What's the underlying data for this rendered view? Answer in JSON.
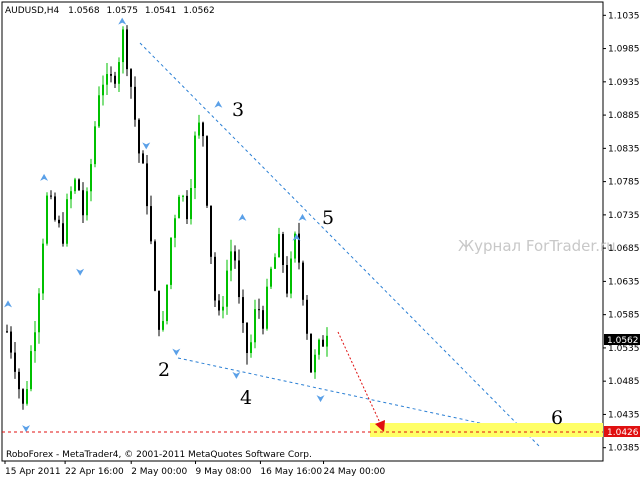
{
  "header": {
    "symbol": "AUDUSD,H4",
    "open": "1.0568",
    "high": "1.0575",
    "low": "1.0541",
    "close": "1.0562"
  },
  "watermark": "Журнал ForTrader.ru",
  "footer": {
    "copyright": "RoboForex - MetaTrader4, © 2001-2011 MetaQuotes Software Corp."
  },
  "colors": {
    "bull_candle": "#00c000",
    "bear_candle": "#000000",
    "fractal_arrow": "#5aa0e8",
    "trend_line": "#2a7fd4",
    "target_arrow": "#e01010",
    "target_zone": "#ffff66",
    "level_line": "#e01010",
    "current_price_tag": "#000000",
    "level_tag": "#e01010"
  },
  "chart_data": {
    "type": "candlestick",
    "instrument": "AUDUSD",
    "timeframe": "H4",
    "ylim": [
      1.0365,
      1.1055
    ],
    "y_ticks": [
      "1.1035",
      "1.0985",
      "1.0935",
      "1.0885",
      "1.0835",
      "1.0785",
      "1.0735",
      "1.0685",
      "1.0635",
      "1.0585",
      "1.0535",
      "1.0485",
      "1.0435",
      "1.0385"
    ],
    "x_ticks": [
      "15 Apr 2011",
      "22 Apr 16:00",
      "2 May 00:00",
      "9 May 08:00",
      "16 May 16:00",
      "24 May 00:00"
    ],
    "current_price": "1.0562",
    "target_level": "1.0426",
    "wave_points": [
      {
        "label": "2",
        "price": 1.054
      },
      {
        "label": "3",
        "price": 1.089
      },
      {
        "label": "4",
        "price": 1.0505
      },
      {
        "label": "5",
        "price": 1.072
      },
      {
        "label": "6",
        "price": 1.0426
      }
    ],
    "close_path": [
      1.056,
      1.052,
      1.044,
      1.052,
      1.062,
      1.076,
      1.073,
      1.07,
      1.076,
      1.079,
      1.072,
      1.084,
      1.095,
      1.092,
      1.096,
      1.101,
      1.092,
      1.082,
      1.076,
      1.06,
      1.056,
      1.07,
      1.078,
      1.074,
      1.084,
      1.088,
      1.07,
      1.056,
      1.064,
      1.07,
      1.056,
      1.052,
      1.06,
      1.058,
      1.066,
      1.069,
      1.062,
      1.07,
      1.062,
      1.05,
      1.053,
      1.057
    ],
    "fractals_up": [
      [
        1.059,
        0.01
      ],
      [
        1.078,
        0.07
      ],
      [
        1.1015,
        0.2
      ],
      [
        1.089,
        0.36
      ],
      [
        1.072,
        0.4
      ],
      [
        1.069,
        0.49
      ],
      [
        1.072,
        0.5
      ]
    ],
    "fractals_down": [
      [
        1.0425,
        0.04
      ],
      [
        1.066,
        0.13
      ],
      [
        1.085,
        0.24
      ],
      [
        1.054,
        0.29
      ],
      [
        1.0505,
        0.39
      ],
      [
        1.047,
        0.53
      ]
    ]
  }
}
